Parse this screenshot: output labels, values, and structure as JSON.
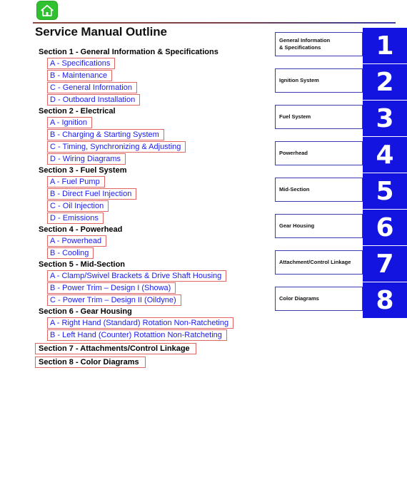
{
  "header": {
    "home_icon": "home-icon",
    "title": "Service Manual Outline"
  },
  "outline": {
    "sections": [
      {
        "heading": "Section 1 - General Information & Specifications",
        "linked": false,
        "items": [
          "A - Specifications",
          "B - Maintenance",
          "C - General Information",
          "D - Outboard Installation"
        ]
      },
      {
        "heading": "Section 2 - Electrical",
        "linked": false,
        "items": [
          "A - Ignition",
          "B - Charging & Starting System",
          "C - Timing, Synchronizing & Adjusting",
          "D - Wiring Diagrams"
        ]
      },
      {
        "heading": "Section 3 - Fuel System",
        "linked": false,
        "items": [
          "A - Fuel Pump",
          "B - Direct Fuel Injection",
          "C - Oil Injection",
          "D - Emissions"
        ]
      },
      {
        "heading": "Section 4 - Powerhead",
        "linked": false,
        "items": [
          "A - Powerhead",
          "B - Cooling"
        ]
      },
      {
        "heading": "Section 5 - Mid-Section",
        "linked": false,
        "items": [
          "A - Clamp/Swivel Brackets & Drive Shaft Housing",
          "B - Power Trim – Design I (Showa)",
          "C - Power Trim – Design II (Oildyne)"
        ]
      },
      {
        "heading": "Section 6 - Gear Housing",
        "linked": false,
        "items": [
          "A - Right Hand (Standard) Rotation Non-Ratcheting",
          "B - Left Hand (Counter) Rotattion Non-Ratcheting"
        ]
      },
      {
        "heading": "Section 7 - Attachments/Control Linkage",
        "linked": true,
        "items": []
      },
      {
        "heading": "Section 8 - Color Diagrams",
        "linked": true,
        "items": []
      }
    ]
  },
  "tab_panel": {
    "tabs": [
      {
        "number": "1",
        "label": "General Information\n& Specifications"
      },
      {
        "number": "2",
        "label": "Ignition System"
      },
      {
        "number": "3",
        "label": "Fuel System"
      },
      {
        "number": "4",
        "label": "Powerhead"
      },
      {
        "number": "5",
        "label": "Mid-Section"
      },
      {
        "number": "6",
        "label": "Gear Housing"
      },
      {
        "number": "7",
        "label": "Attachment/Control Linkage"
      },
      {
        "number": "8",
        "label": "Color Diagrams"
      }
    ]
  },
  "colors": {
    "tab_blue": "#1414e0",
    "link_blue": "#1a1aee",
    "link_box_red": "#e06666",
    "home_green": "#2fc12f"
  }
}
